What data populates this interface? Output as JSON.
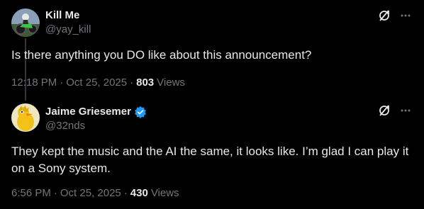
{
  "tweets": [
    {
      "display_name": "Kill Me",
      "handle": "@yay_kill",
      "verified": false,
      "text": "Is there anything you DO like about this announcement?",
      "time": "12:18 PM",
      "date": "Oct 25, 2025",
      "separator": "·",
      "views_count": "803",
      "views_label": "Views",
      "avatar_icon": "motocross-rider-avatar"
    },
    {
      "display_name": "Jaime Griesemer",
      "handle": "@32nds",
      "verified": true,
      "text": "They kept the music and the AI the same, it looks like. I’m glad I can play it on a Sony system.",
      "time": "6:56 PM",
      "date": "Oct 25, 2025",
      "separator": "·",
      "views_count": "430",
      "views_label": "Views",
      "avatar_icon": "yellow-bird-avatar"
    }
  ],
  "colors": {
    "background": "#000000",
    "primary_text": "#e7e9ea",
    "secondary_text": "#71767b",
    "verified_blue": "#1d9bf0",
    "thread_line": "#333639"
  },
  "icons": {
    "grok": "grok-icon",
    "more": "more-icon",
    "verified": "verified-badge-icon"
  }
}
